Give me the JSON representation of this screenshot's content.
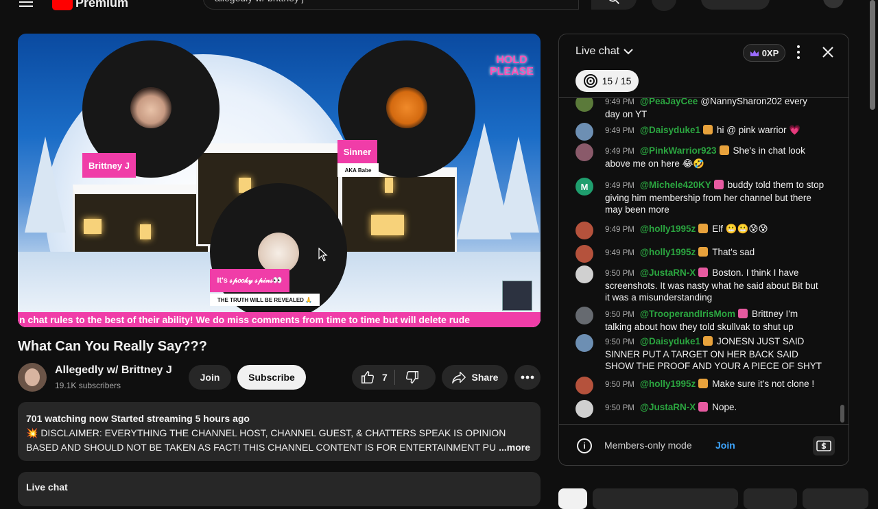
{
  "topbar": {
    "logo_text": "Premium",
    "search_value": "allegedly w/ brittney j"
  },
  "video": {
    "overlay": {
      "hold_please_line1": "HOLD",
      "hold_please_line2": "PLEASE",
      "host_name": "Brittney J",
      "guest_name": "Sinner",
      "guest_sub": "AKA Babe",
      "third_name": "It's 𝓈𝓅𝑜𝑜𝓀𝓎 𝓈𝓅𝒾𝓃𝓈👀",
      "third_sub": "THE TRUTH WILL BE REVEALED 🙏",
      "ticker": "n chat rules to the best of their ability! We do miss comments from time to time but will delete rude"
    },
    "title": "What Can You Really Say???",
    "channel_name": "Allegedly w/ Brittney J",
    "subscribers": "19.1K subscribers",
    "join_label": "Join",
    "subscribe_label": "Subscribe",
    "like_count": "7",
    "share_label": "Share",
    "description": {
      "meta": "701 watching now  Started streaming 5 hours ago",
      "line1": "💥 DISCLAIMER: EVERYTHING THE CHANNEL HOST, CHANNEL GUEST, & CHATTERS SPEAK IS OPINION",
      "line2": "BASED AND SHOULD NOT BE TAKEN AS FACT!  THIS CHANNEL CONTENT IS FOR ENTERTAINMENT PU",
      "more": "...more"
    },
    "live_chat_label": "Live chat"
  },
  "chat": {
    "title": "Live chat",
    "xp": "0XP",
    "goal": "15 / 15",
    "members_only": "Members-only mode",
    "join": "Join",
    "messages": [
      {
        "time": "9:49 PM",
        "author": "@PeaJayCee",
        "text": "@NannySharon202 every day on YT",
        "badge": "",
        "avatar_color": "#5b7a3a"
      },
      {
        "time": "9:49 PM",
        "author": "@Daisyduke1",
        "text": "hi @ pink warrior 💗",
        "badge": "orange",
        "avatar_color": "#6d8fb3"
      },
      {
        "time": "9:49 PM",
        "author": "@PinkWarrior923",
        "text": "She's in chat look above me on here 😂🤣",
        "badge": "orange",
        "avatar_color": "#8a5a6a"
      },
      {
        "time": "9:49 PM",
        "author": "@Michele420KY",
        "text": "buddy told them to stop giving him membership from her channel but there may been more",
        "badge": "pink",
        "avatar_color": "#1f9e6e",
        "initial": "M"
      },
      {
        "time": "9:49 PM",
        "author": "@holly1995z",
        "text": "Elf 😬😬😰😰",
        "badge": "orange",
        "avatar_color": "#b5523c"
      },
      {
        "time": "9:49 PM",
        "author": "@holly1995z",
        "text": "That's sad",
        "badge": "orange",
        "avatar_color": "#b5523c"
      },
      {
        "time": "9:50 PM",
        "author": "@JustaRN-X",
        "text": "Boston. I think I have screenshots. It was nasty what he said about Bit but it was a misunderstanding",
        "badge": "pink",
        "avatar_color": "#d0d0d0"
      },
      {
        "time": "9:50 PM",
        "author": "@TrooperandIrisMom",
        "text": "Brittney I'm talking about how they told skullvak to shut up",
        "badge": "pink",
        "avatar_color": "#666a70"
      },
      {
        "time": "9:50 PM",
        "author": "@Daisyduke1",
        "text": "JONESN JUST SAID SINNER PUT A TARGET ON HER BACK SAID SHOW THE PROOF AND YOUR A PIECE OF SHYT",
        "badge": "orange",
        "avatar_color": "#6d8fb3"
      },
      {
        "time": "9:50 PM",
        "author": "@holly1995z",
        "text": "Make sure it's not clone !",
        "badge": "orange",
        "avatar_color": "#b5523c"
      },
      {
        "time": "9:50 PM",
        "author": "@JustaRN-X",
        "text": "Nope.",
        "badge": "pink",
        "avatar_color": "#d0d0d0"
      }
    ]
  }
}
